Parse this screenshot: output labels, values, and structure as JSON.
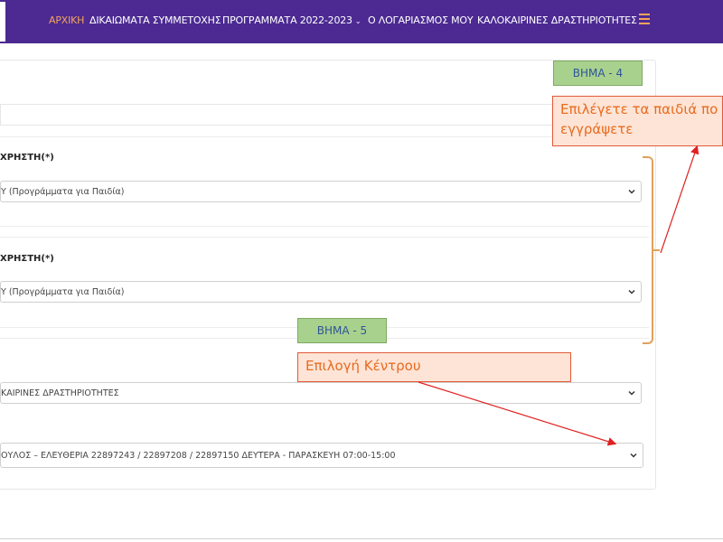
{
  "nav": {
    "items": [
      {
        "label": "ΑΡΧΙΚΗ",
        "active": true
      },
      {
        "label": "ΔΙΚΑΙΩΜΑΤΑ ΣΥΜΜΕΤΟΧΗΣ",
        "active": false
      },
      {
        "label": "ΠΡΟΓΡΑΜΜΑΤΑ 2022-2023",
        "active": false,
        "has_dropdown": true
      },
      {
        "label": "Ο ΛΟΓΑΡΙΑΣΜΟΣ ΜΟΥ",
        "active": false
      },
      {
        "label": "ΚΑΛΟΚΑΙΡΙΝΕΣ ΔΡΑΣΤΗΡΙΟΤΗΤΕΣ",
        "active": false
      }
    ]
  },
  "form": {
    "child1": {
      "label": "ΧΡΗΣΤΗ(*)",
      "select_value": "Υ (Προγράμματα για Παιδία)"
    },
    "child2": {
      "label": "ΧΡΗΣΤΗ(*)",
      "select_value": "Υ (Προγράμματα για Παιδία)"
    },
    "program": {
      "select_value": "ΚΑΙΡΙΝΕΣ ΔΡΑΣΤΗΡΙΟΤΗΤΕΣ"
    },
    "center": {
      "select_value": "ΟΥΛΟΣ – ΕΛΕΥΘΕΡΙΑ 22897243 / 22897208 / 22897150 ΔΕΥΤΕΡΑ - ΠΑΡΑΣΚΕΥΗ 07:00-15:00"
    }
  },
  "annotations": {
    "step4": "ΒΗΜΑ - 4",
    "step5": "ΒΗΜΑ - 5",
    "callout_children_line1": "Επιλέγετε τα παιδιά πο",
    "callout_children_line2": "εγγράψετε",
    "callout_center": "Επιλογή Κέντρου"
  },
  "colors": {
    "nav_bg": "#4c2a92",
    "nav_active": "#f5a45a",
    "step_bg": "#a9d18e",
    "callout_bg": "#fde4d6",
    "callout_border": "#e25a3a",
    "arrow": "#e02020"
  }
}
